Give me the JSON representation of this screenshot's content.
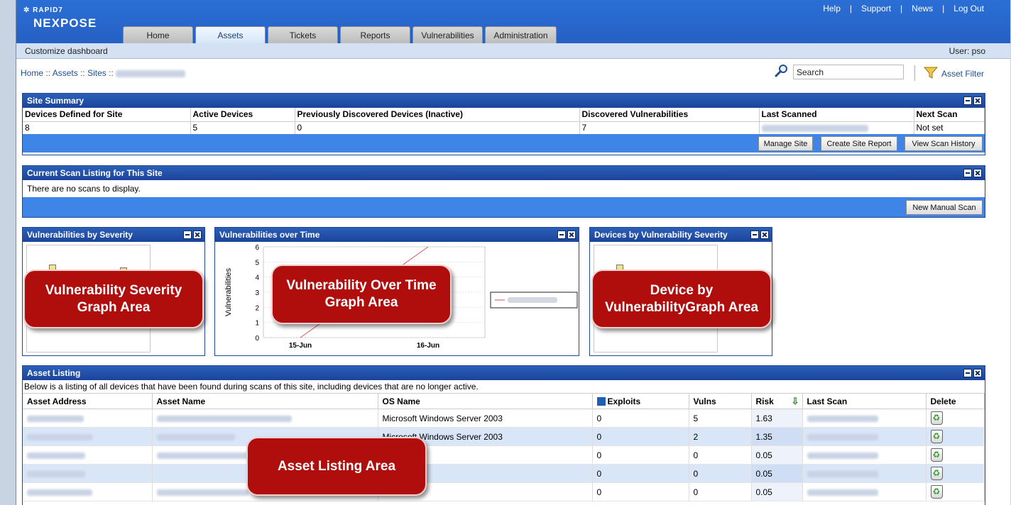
{
  "header": {
    "brand_small": "RAPID7",
    "brand_big": "NEXPOSE",
    "links": [
      "Help",
      "Support",
      "News",
      "Log Out"
    ]
  },
  "tabs": [
    {
      "label": "Home",
      "active": false
    },
    {
      "label": "Assets",
      "active": true
    },
    {
      "label": "Tickets",
      "active": false
    },
    {
      "label": "Reports",
      "active": false
    },
    {
      "label": "Vulnerabilities",
      "active": false
    },
    {
      "label": "Administration",
      "active": false
    }
  ],
  "subbar": {
    "left": "Customize dashboard",
    "user": "User: pso"
  },
  "breadcrumb": {
    "home": "Home",
    "sep": "::",
    "assets": "Assets",
    "sites": "Sites"
  },
  "search": {
    "value": "Search",
    "filter_label": "Asset Filter"
  },
  "site_summary": {
    "title": "Site Summary",
    "headers": [
      "Devices Defined for Site",
      "Active Devices",
      "Previously Discovered Devices (Inactive)",
      "Discovered Vulnerabilities",
      "Last Scanned",
      "Next Scan"
    ],
    "values": [
      "8",
      "5",
      "0",
      "7",
      "",
      "Not set"
    ],
    "buttons": [
      "Manage Site",
      "Create Site Report",
      "View Scan History"
    ]
  },
  "scan_listing": {
    "title": "Current Scan Listing for This Site",
    "empty": "There are no scans to display.",
    "button": "New Manual Scan"
  },
  "widgets": {
    "severity_title": "Vulnerabilities by Severity",
    "over_time_title": "Vulnerabilities over Time",
    "devices_title": "Devices by Vulnerability Severity"
  },
  "chart_data": {
    "type": "line",
    "x": [
      "15-Jun",
      "16-Jun"
    ],
    "series": [
      {
        "values": [
          0,
          6
        ]
      }
    ],
    "ylabel": "Vulnerabilities",
    "ylim": [
      0,
      6
    ],
    "yticks": [
      "0",
      "1",
      "2",
      "3",
      "4",
      "5",
      "6"
    ]
  },
  "callouts": {
    "severity": "Vulnerability Severity Graph Area",
    "over_time": "Vulnerability Over Time Graph Area",
    "devices": "Device by VulnerabilityGraph Area",
    "assets": "Asset Listing Area"
  },
  "asset_listing": {
    "title": "Asset Listing",
    "description": "Below is a listing of all devices that have been found during scans of this site, including devices that are no longer active.",
    "headers": [
      "Asset Address",
      "Asset Name",
      "OS Name",
      "Exploits",
      "Vulns",
      "Risk",
      "Last Scan",
      "Delete"
    ],
    "rows": [
      {
        "os": "Microsoft Windows Server 2003",
        "exploits": "0",
        "vulns": "5",
        "risk": "1.63"
      },
      {
        "os": "Microsoft Windows Server 2003",
        "exploits": "0",
        "vulns": "2",
        "risk": "1.35"
      },
      {
        "os": "",
        "exploits": "0",
        "vulns": "0",
        "risk": "0.05"
      },
      {
        "os": "",
        "exploits": "0",
        "vulns": "0",
        "risk": "0.05"
      },
      {
        "os": "",
        "exploits": "0",
        "vulns": "0",
        "risk": "0.05"
      }
    ]
  },
  "colors": {
    "header_blue": "#2660c4",
    "panel_blue": "#1f4a8e",
    "band_blue": "#3f85e8",
    "callout_red": "#b00d0d"
  }
}
